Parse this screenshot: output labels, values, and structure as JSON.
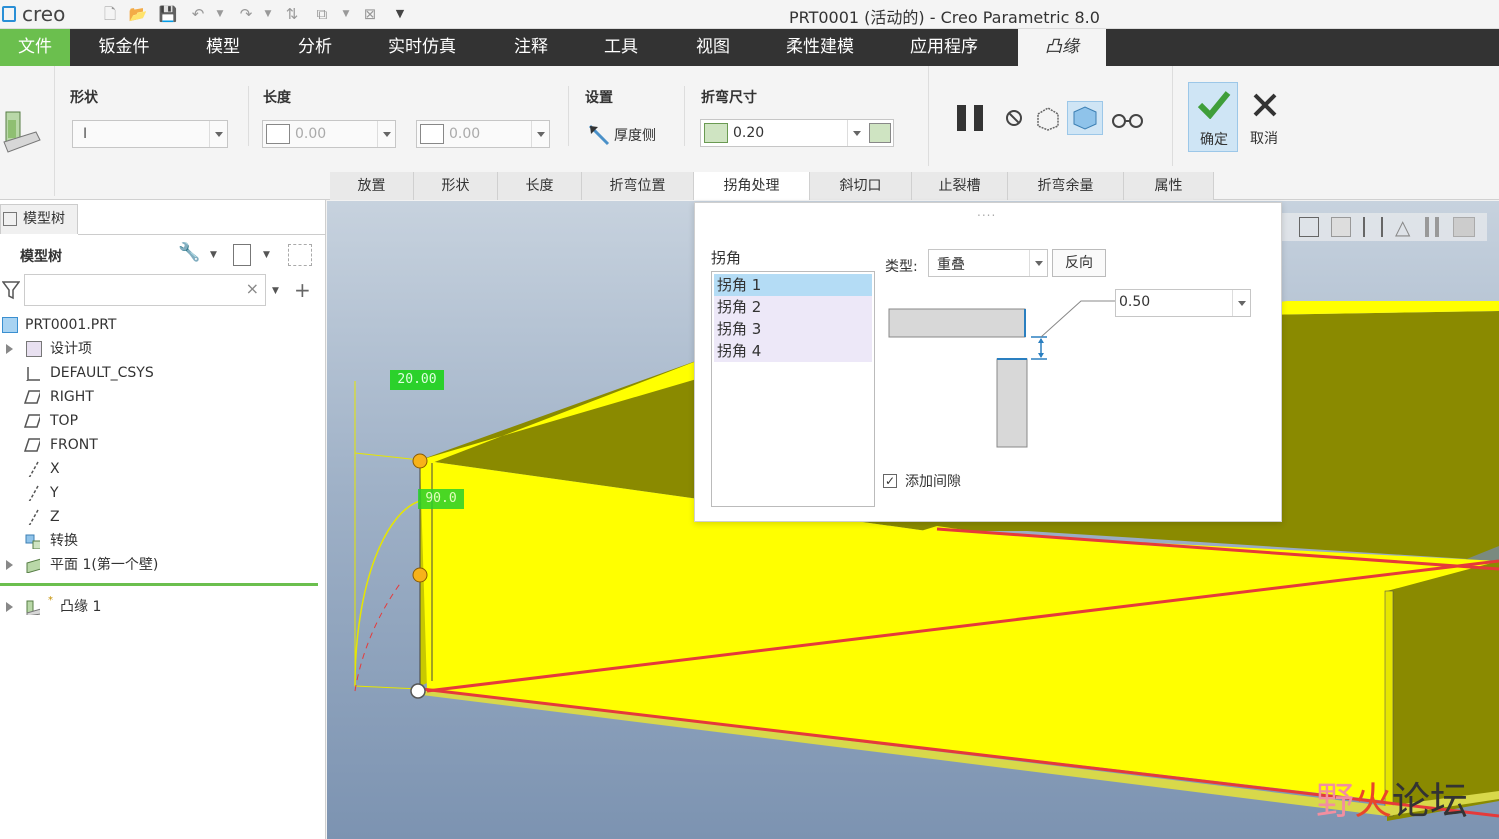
{
  "app": {
    "logo_text": "creo",
    "window_title": "PRT0001 (活动的) - Creo Parametric 8.0"
  },
  "menu": {
    "tabs": [
      "文件",
      "钣金件",
      "模型",
      "分析",
      "实时仿真",
      "注释",
      "工具",
      "视图",
      "柔性建模",
      "应用程序",
      "凸缘"
    ]
  },
  "ribbon": {
    "shape_label": "形状",
    "shape_value": "I",
    "length_label": "长度",
    "length_value_1": "0.00",
    "length_value_2": "0.00",
    "settings_label": "设置",
    "thickness_side_label": "厚度侧",
    "bend_size_label": "折弯尺寸",
    "bend_size_value": "0.20",
    "ok_label": "确定",
    "cancel_label": "取消",
    "subtabs": [
      "放置",
      "形状",
      "长度",
      "折弯位置",
      "拐角处理",
      "斜切口",
      "止裂槽",
      "折弯余量",
      "属性"
    ]
  },
  "tree": {
    "tab_label": "模型树",
    "header_label": "模型树",
    "search_value": "",
    "items": [
      {
        "label": "PRT0001.PRT",
        "expandable": false,
        "icon": "part-icon"
      },
      {
        "label": "设计项",
        "expandable": true,
        "icon": "design-items-icon"
      },
      {
        "label": "DEFAULT_CSYS",
        "expandable": false,
        "icon": "csys-icon"
      },
      {
        "label": "RIGHT",
        "expandable": false,
        "icon": "datum-plane-icon"
      },
      {
        "label": "TOP",
        "expandable": false,
        "icon": "datum-plane-icon"
      },
      {
        "label": "FRONT",
        "expandable": false,
        "icon": "datum-plane-icon"
      },
      {
        "label": "X",
        "expandable": false,
        "icon": "axis-icon"
      },
      {
        "label": "Y",
        "expandable": false,
        "icon": "axis-icon"
      },
      {
        "label": "Z",
        "expandable": false,
        "icon": "axis-icon"
      },
      {
        "label": "转换",
        "expandable": false,
        "icon": "convert-icon"
      },
      {
        "label": "平面 1(第一个壁)",
        "expandable": true,
        "icon": "planar-wall-icon"
      },
      {
        "label": "凸缘 1",
        "expandable": true,
        "icon": "flange-icon"
      }
    ]
  },
  "viewport": {
    "dim_length": "20.00",
    "dim_angle": "90.0"
  },
  "corner_panel": {
    "section_label": "拐角",
    "corners": [
      "拐角 1",
      "拐角 2",
      "拐角 3",
      "拐角 4"
    ],
    "selected_index": 0,
    "type_label": "类型:",
    "type_value": "重叠",
    "reverse_label": "反向",
    "gap_value": "0.50",
    "add_gap_label": "添加间隙",
    "add_gap_checked": true
  },
  "watermark": {
    "text_1": "野",
    "text_2": "火",
    "text_3": "论坛"
  },
  "colors": {
    "accent_green": "#6bbf4e",
    "menubar": "#333333",
    "model_yellow": "#ffff00",
    "model_olive": "#8a8a00",
    "edge_red": "#e53a3a",
    "selected_corner": "#b4dcf5"
  }
}
